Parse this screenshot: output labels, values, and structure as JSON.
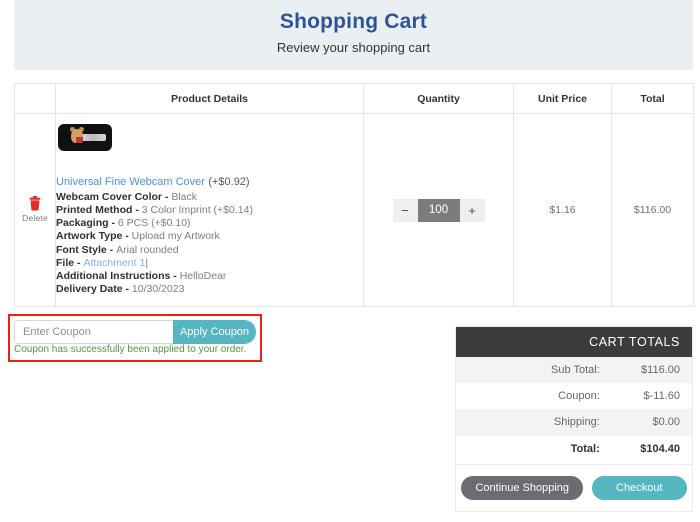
{
  "header": {
    "title": "Shopping Cart",
    "subtitle": "Review your shopping cart",
    "title_color": "#2f5496",
    "background": "#eaeff3"
  },
  "table": {
    "columns": {
      "remove": "",
      "details": "Product Details",
      "quantity": "Quantity",
      "unit_price": "Unit Price",
      "total": "Total"
    },
    "rows": [
      {
        "remove_label": "Delete",
        "remove_icon": "trash-icon",
        "thumbnail_alt": "webcam-cover-thumbnail",
        "product_name": "Universal Fine Webcam Cover",
        "product_price_modifier": "(+$0.92)",
        "attributes": [
          {
            "label": "Webcam Cover Color",
            "value": "Black"
          },
          {
            "label": "Printed Method",
            "value": "3 Color Imprint (+$0.14)"
          },
          {
            "label": "Packaging",
            "value": "6 PCS (+$0.10)"
          },
          {
            "label": "Artwork Type",
            "value": "Upload my Artwork"
          },
          {
            "label": "Font Style",
            "value": "Arial rounded"
          },
          {
            "label": "File",
            "value": "Attachment 1",
            "value_is_link": true,
            "suffix": "|"
          },
          {
            "label": "Additional Instructions",
            "value": "HelloDear"
          },
          {
            "label": "Delivery Date",
            "value": "10/30/2023"
          }
        ],
        "qty_decrease": "−",
        "qty_value": "100",
        "qty_increase": "+",
        "unit_price": "$1.16",
        "total": "$116.00"
      }
    ]
  },
  "coupon": {
    "placeholder": "Enter Coupon",
    "value": "",
    "apply_label": "Apply Coupon",
    "message": "Coupon has successfully been applied to your order.",
    "message_color": "#4e9a3f",
    "highlight_color": "#e8211b",
    "accent_color": "#55b5c1"
  },
  "totals": {
    "heading": "CART TOTALS",
    "rows": [
      {
        "label": "Sub Total:",
        "value": "$116.00"
      },
      {
        "label": "Coupon:",
        "value": "$-11.60"
      },
      {
        "label": "Shipping:",
        "value": "$0.00"
      },
      {
        "label": "Total:",
        "value": "$104.40"
      }
    ],
    "continue_label": "Continue Shopping",
    "checkout_label": "Checkout",
    "header_color": "#3c3c3c",
    "checkout_color": "#55b5c1",
    "continue_color": "#6b6b73"
  }
}
